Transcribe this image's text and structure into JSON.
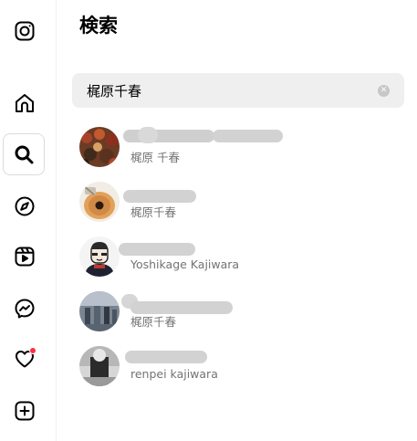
{
  "search_panel": {
    "title": "検索",
    "query": "梶原千春"
  },
  "results": [
    {
      "subtitle": "梶原 千春"
    },
    {
      "subtitle": "梶原千春"
    },
    {
      "subtitle": "Yoshikage Kajiwara"
    },
    {
      "subtitle": "梶原千春"
    },
    {
      "subtitle": "renpei kajiwara"
    }
  ],
  "colors": {
    "notification_dot": "#ff3040",
    "search_bg": "#efefef",
    "subtitle_text": "#737373"
  },
  "icons": [
    "instagram-logo-icon",
    "home-icon",
    "search-icon",
    "explore-icon",
    "reels-icon",
    "messenger-icon",
    "heart-icon",
    "create-icon",
    "clear-icon"
  ]
}
